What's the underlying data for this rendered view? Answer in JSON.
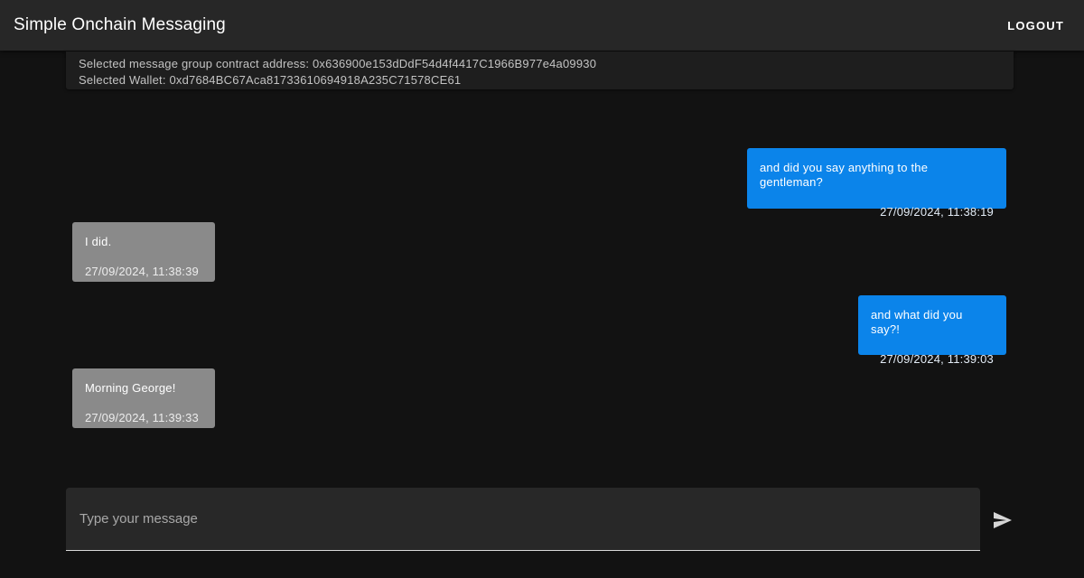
{
  "app": {
    "title": "Simple Onchain Messaging",
    "logout_label": "LOGOUT"
  },
  "info": {
    "contract_line": "Selected message group contract address: 0x636900e153dDdF54d4f4417C1966B977e4a09930",
    "wallet_line": "Selected Wallet: 0xd7684BC67Aca81733610694918A235C71578CE61"
  },
  "messages": [
    {
      "direction": "sent",
      "text": "and did you say anything to the gentleman?",
      "time": "27/09/2024, 11:38:19"
    },
    {
      "direction": "received",
      "text": "I did.",
      "time": "27/09/2024, 11:38:39"
    },
    {
      "direction": "sent",
      "text": "and what did you say?!",
      "time": "27/09/2024, 11:39:03"
    },
    {
      "direction": "received",
      "text": "Morning George!",
      "time": "27/09/2024, 11:39:33"
    }
  ],
  "composer": {
    "placeholder": "Type your message",
    "value": ""
  },
  "icons": {
    "send": "send-icon"
  },
  "colors": {
    "sent_bubble": "#0b84ea",
    "received_bubble": "#8a8a8a",
    "background": "#121212",
    "app_bar": "#272727"
  }
}
